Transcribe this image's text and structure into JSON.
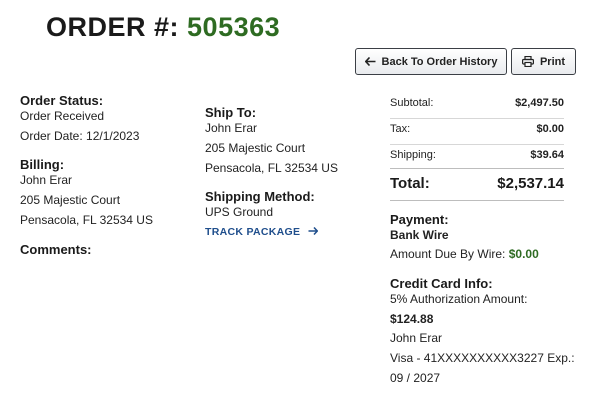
{
  "header": {
    "order_label": "ORDER #:",
    "order_number": "505363"
  },
  "toolbar": {
    "back_label": "Back To Order History",
    "print_label": "Print"
  },
  "order": {
    "status_label": "Order Status:",
    "status_value": "Order Received",
    "date_text": "Order Date: 12/1/2023"
  },
  "billing": {
    "label": "Billing:",
    "name": "John Erar",
    "address1": "205 Majestic Court",
    "address2": "Pensacola, FL 32534 US"
  },
  "comments": {
    "label": "Comments:"
  },
  "shipping": {
    "label": "Ship To:",
    "name": "John Erar",
    "address1": "205 Majestic Court",
    "address2": "Pensacola, FL 32534 US",
    "method_label": "Shipping Method:",
    "method_value": "UPS Ground",
    "track_label": "TRACK PACKAGE"
  },
  "summary": {
    "subtotal_label": "Subtotal:",
    "subtotal_value": "$2,497.50",
    "tax_label": "Tax:",
    "tax_value": "$0.00",
    "shipping_label": "Shipping:",
    "shipping_value": "$39.64",
    "total_label": "Total:",
    "total_value": "$2,537.14"
  },
  "payment": {
    "label": "Payment:",
    "method": "Bank Wire",
    "due_label": "Amount Due By Wire:",
    "due_value": "$0.00"
  },
  "credit_card": {
    "label": "Credit Card Info:",
    "auth_label": "5% Authorization Amount:",
    "auth_value": "$124.88",
    "name": "John Erar",
    "card_line1": "Visa - 41XXXXXXXXXX3227 Exp.:",
    "card_line2": "09 / 2027"
  },
  "colors": {
    "accent_green": "#2e6b22",
    "link_blue": "#1f4e8c"
  }
}
